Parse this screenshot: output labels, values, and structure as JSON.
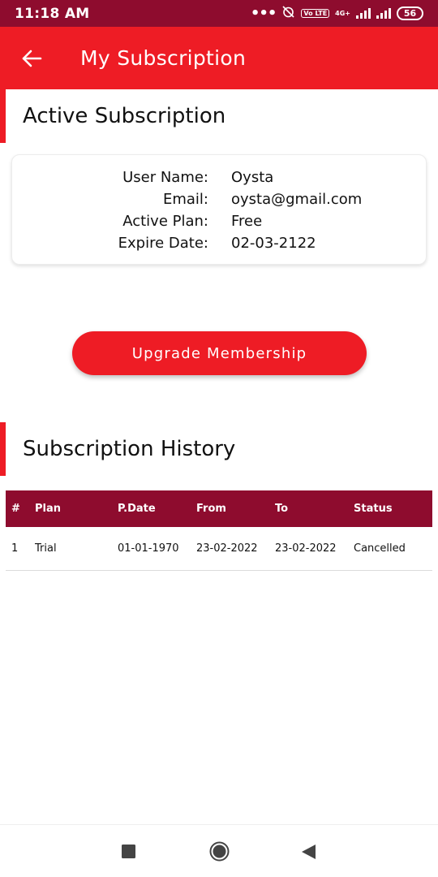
{
  "status_bar": {
    "time": "11:18 AM",
    "volte": "Vo LTE",
    "network": "4G+",
    "battery": "56"
  },
  "app_bar": {
    "title": "My Subscription"
  },
  "active_subscription": {
    "title": "Active Subscription",
    "rows": [
      {
        "label": "User Name:",
        "value": "Oysta"
      },
      {
        "label": "Email:",
        "value": "oysta@gmail.com"
      },
      {
        "label": "Active Plan:",
        "value": "Free"
      },
      {
        "label": "Expire Date:",
        "value": "02-03-2122"
      }
    ]
  },
  "upgrade_button": {
    "label": "Upgrade Membership"
  },
  "history": {
    "title": "Subscription History",
    "columns": [
      "#",
      "Plan",
      "P.Date",
      "From",
      "To",
      "Status"
    ],
    "rows": [
      [
        "1",
        "Trial",
        "01-01-1970",
        "23-02-2022",
        "23-02-2022",
        "Cancelled"
      ]
    ]
  },
  "colors": {
    "primary": "#ee1c25",
    "dark": "#8e0c2e"
  }
}
